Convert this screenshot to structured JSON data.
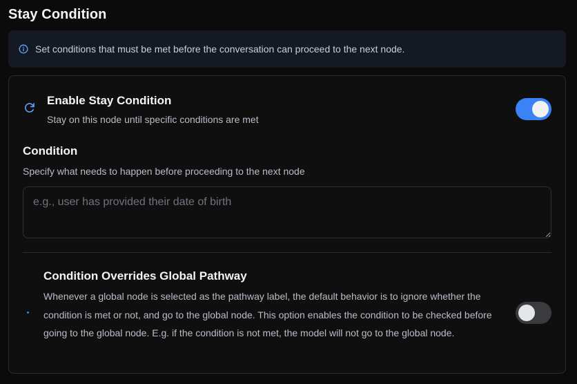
{
  "section": {
    "title": "Stay Condition"
  },
  "info_banner": {
    "icon": "info-circle-icon",
    "text": "Set conditions that must be met before the conversation can proceed to the next node."
  },
  "enable": {
    "icon": "refresh-icon",
    "title": "Enable Stay Condition",
    "description": "Stay on this node until specific conditions are met",
    "toggle_state": "on"
  },
  "condition": {
    "title": "Condition",
    "description": "Specify what needs to happen before proceeding to the next node",
    "value": "",
    "placeholder": "e.g., user has provided their date of birth"
  },
  "override": {
    "title": "Condition Overrides Global Pathway",
    "description": "Whenever a global node is selected as the pathway label, the default behavior is to ignore whether the condition is met or not, and go to the global node. This option enables the condition to be checked before going to the global node. E.g. if the condition is not met, the model will not go to the global node.",
    "toggle_state": "off"
  },
  "colors": {
    "background": "#0b0b0c",
    "card": "#0f0f10",
    "banner": "#151a22",
    "accent": "#3b82f6",
    "toggle_off": "#3a3b3f"
  }
}
